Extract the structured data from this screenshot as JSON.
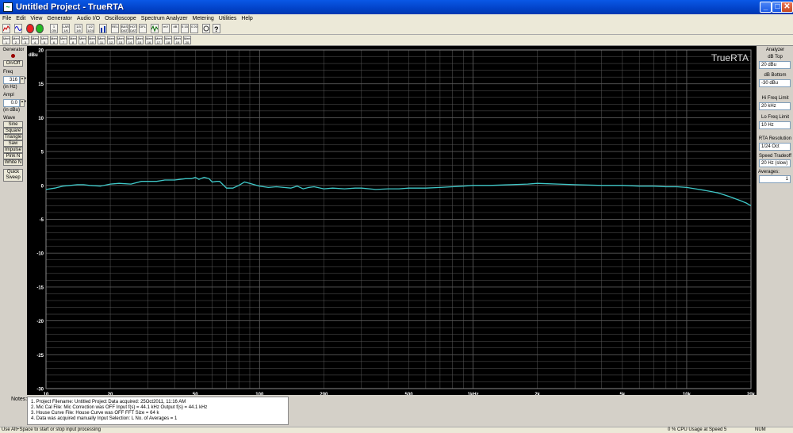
{
  "window": {
    "title": "Untitled Project - TrueRTA"
  },
  "menu": [
    "File",
    "Edit",
    "View",
    "Generator",
    "Audio I/O",
    "Oscilloscope",
    "Spectrum Analyzer",
    "Metering",
    "Utilities",
    "Help"
  ],
  "toolbar1": [
    "1 ON",
    "LAR 1/6",
    "1/3 1/6",
    "1/2 1/24",
    "REL",
    "BASE DAT",
    "HOT DAT",
    "OFL",
    "mV",
    "dB",
    "5 15",
    "0 20"
  ],
  "toolbar2": [
    "Mem 1",
    "Mem 2",
    "Mem 3",
    "Mem 4",
    "Mem 5",
    "Mem 6",
    "Mem 7",
    "Mem 8",
    "Mem 9",
    "Mem 10",
    "Mem 11",
    "Mem 12",
    "Mem 13",
    "Mem 14",
    "Mem 15",
    "Mem 16",
    "Mem 17",
    "Mem 18",
    "Mem 19",
    "Mem 20"
  ],
  "generator": {
    "title": "Generator",
    "onoff": "On/Off",
    "freq_label": "Freq",
    "freq_value": "316",
    "freq_unit": "(in Hz)",
    "ampl_label": "Ampl",
    "ampl_value": "0.0",
    "ampl_unit": "(in dBu)",
    "wave_label": "Wave",
    "waves": [
      "Sine",
      "Square",
      "Triangle",
      "Saw",
      "Impulse",
      "Pink N",
      "White N"
    ],
    "quick_sweep": "Quick Sweep"
  },
  "analyzer": {
    "title": "Analyzer",
    "db_top_label": "dB Top",
    "db_top_value": "20 dBu",
    "db_bottom_label": "dB Bottom",
    "db_bottom_value": "-30 dBu",
    "hi_freq_label": "Hi Freq Limit",
    "hi_freq_value": "20 kHz",
    "lo_freq_label": "Lo Freq Limit",
    "lo_freq_value": "10 Hz",
    "resolution_label": "RTA Resolution",
    "resolution_value": "1/24 Oct",
    "speed_label": "Speed Tradeoff",
    "speed_value": "20 Hz (slow)",
    "averages_label": "Averages:",
    "averages_value": "1"
  },
  "notes": {
    "label": "Notes:",
    "lines": [
      "1. Project Filename: Untitled Project        Data acquired: 25Oct2011, 11:16 AM",
      "2. Mic Cal File: Mic Correction was OFF        Input f(s) = 44.1 kHz        Output f(s) = 44.1 kHz",
      "3. House Curve File: House Curve was OFF        FFT Size = 64 k",
      "4. Data was acquired manually        Input Selection: L        No. of Averages = 1"
    ]
  },
  "status": {
    "hint": "Use Alt+Space to start or stop input processing",
    "cpu": "0 % CPU Usage at Speed 5",
    "num": "NUM"
  },
  "colors": {
    "trace": "#3fc8c8",
    "grid": "#5a5a5a",
    "background": "#000000",
    "title_bar": "#0a58e6"
  },
  "chart_data": {
    "type": "line",
    "brand": "TrueRTA",
    "ylabel": "dBu",
    "ylim": [
      -30,
      20
    ],
    "xlim": [
      10,
      20000
    ],
    "x_scale": "log",
    "grid": true,
    "y_ticks": [
      "20",
      "15",
      "10",
      "5",
      "0",
      "-5",
      "-10",
      "-15",
      "-20",
      "-25",
      "-30"
    ],
    "x_ticks": [
      {
        "v": 10,
        "label": "10"
      },
      {
        "v": 20,
        "label": "20"
      },
      {
        "v": 50,
        "label": "50"
      },
      {
        "v": 100,
        "label": "100"
      },
      {
        "v": 200,
        "label": "200"
      },
      {
        "v": 500,
        "label": "500"
      },
      {
        "v": 1000,
        "label": "1kHz"
      },
      {
        "v": 2000,
        "label": "2k"
      },
      {
        "v": 5000,
        "label": "5k"
      },
      {
        "v": 10000,
        "label": "10k"
      },
      {
        "v": 20000,
        "label": "20k"
      }
    ],
    "series": [
      {
        "x": [
          10,
          11,
          12,
          13,
          14,
          15,
          16,
          18,
          20,
          22,
          25,
          28,
          30,
          33,
          36,
          40,
          45,
          48,
          50,
          52,
          55,
          58,
          60,
          63,
          65,
          70,
          75,
          80,
          85,
          90,
          100,
          110,
          120,
          130,
          140,
          150,
          160,
          170,
          180,
          200,
          220,
          250,
          280,
          300,
          350,
          400,
          450,
          500,
          600,
          700,
          800,
          900,
          1000,
          1200,
          1500,
          1800,
          2000,
          2500,
          3000,
          4000,
          5000,
          6000,
          7000,
          8000,
          9000,
          10000,
          11000,
          12000,
          13000,
          14000,
          15000,
          16000,
          17000,
          18000,
          19000,
          20000
        ],
        "y": [
          -0.6,
          -0.4,
          -0.1,
          0.0,
          0.1,
          0.1,
          0.0,
          -0.1,
          0.2,
          0.3,
          0.2,
          0.6,
          0.6,
          0.6,
          0.8,
          0.8,
          1.0,
          1.0,
          1.2,
          0.9,
          1.2,
          1.0,
          0.5,
          0.6,
          0.6,
          -0.4,
          -0.4,
          0.0,
          0.5,
          0.3,
          -0.1,
          -0.3,
          -0.2,
          -0.3,
          -0.4,
          -0.1,
          -0.5,
          -0.3,
          -0.2,
          -0.5,
          -0.4,
          -0.5,
          -0.4,
          -0.4,
          -0.6,
          -0.5,
          -0.5,
          -0.4,
          -0.4,
          -0.3,
          -0.2,
          -0.1,
          0.0,
          0.0,
          0.1,
          0.2,
          0.3,
          0.2,
          0.1,
          0.0,
          0.0,
          -0.1,
          -0.1,
          -0.2,
          -0.2,
          -0.3,
          -0.5,
          -0.7,
          -0.9,
          -1.1,
          -1.4,
          -1.7,
          -2.0,
          -2.3,
          -2.6,
          -3.0
        ]
      }
    ]
  }
}
